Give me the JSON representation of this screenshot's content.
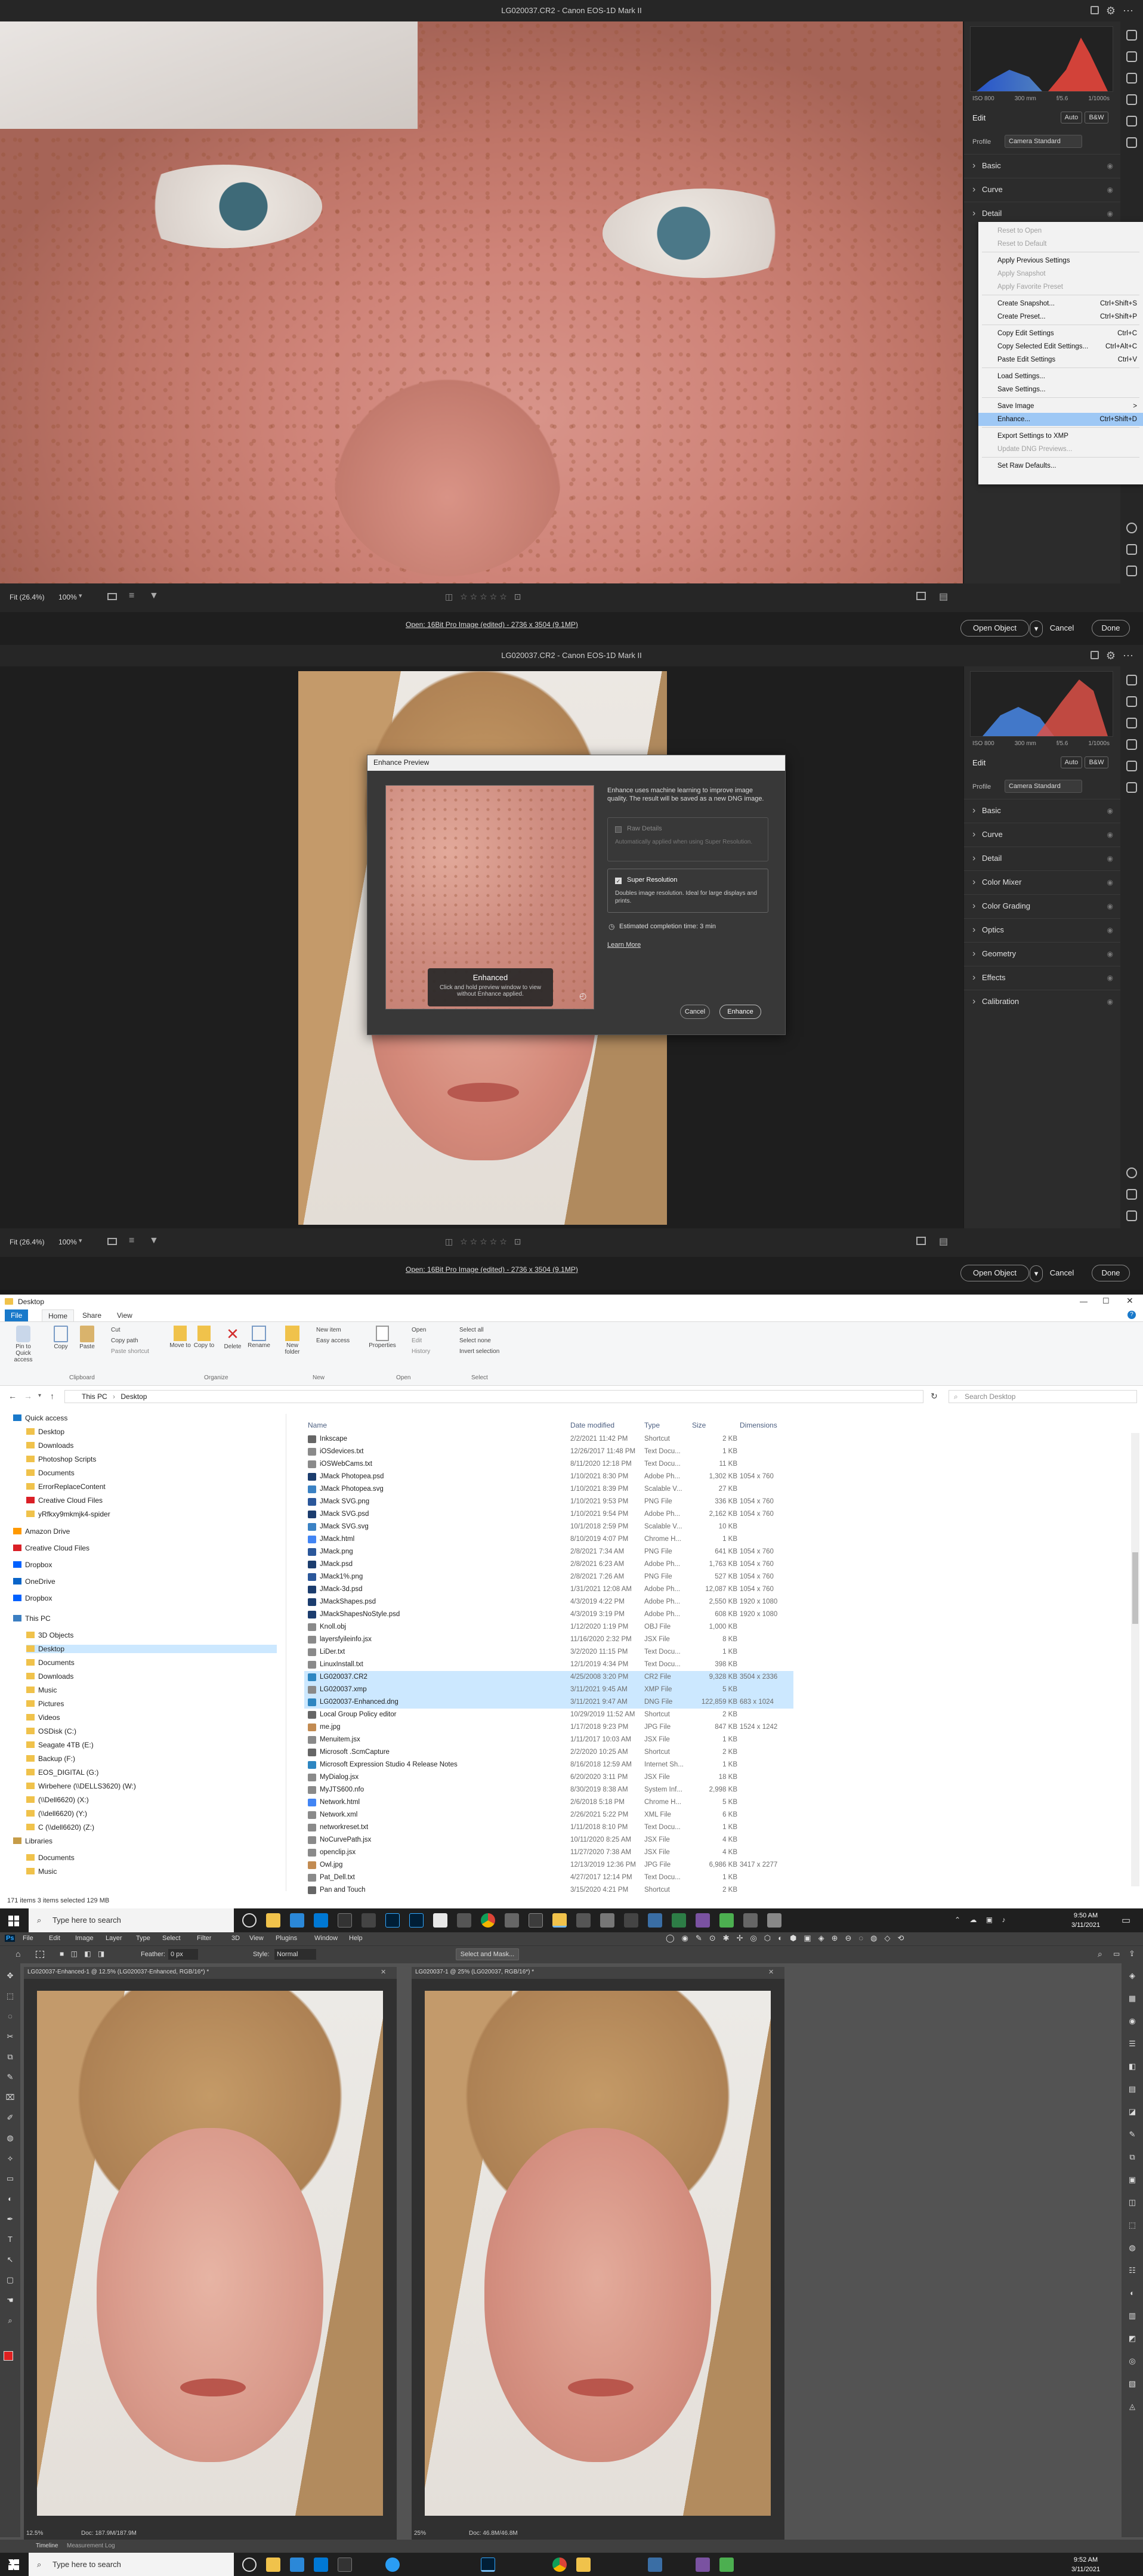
{
  "acr1": {
    "title": "LG020037.CR2  -  Canon EOS-1D Mark II",
    "histogram_info": [
      "ISO 800",
      "300 mm",
      "f/5.6",
      "1/1000s"
    ],
    "edit_label": "Edit",
    "auto_label": "Auto",
    "bw_label": "B&W",
    "profile_label": "Profile",
    "profile_value": "Camera Standard",
    "panels": [
      "Basic",
      "Curve",
      "Detail"
    ],
    "zoom_fit": "Fit (26.4%)",
    "zoom_100": "100%",
    "file_info": "Open: 16Bit Pro Image (edited) - 2736 x 3504 (9.1MP)",
    "open_button": "Open Object",
    "cancel_button": "Cancel",
    "done_button": "Done",
    "menu": [
      {
        "label": "Reset to Open",
        "disabled": true
      },
      {
        "label": "Reset to Default",
        "disabled": true
      },
      {
        "sep": true
      },
      {
        "label": "Apply Previous Settings"
      },
      {
        "label": "Apply Snapshot",
        "disabled": true
      },
      {
        "label": "Apply Favorite Preset",
        "disabled": true
      },
      {
        "sep": true
      },
      {
        "label": "Create Snapshot...",
        "shortcut": "Ctrl+Shift+S"
      },
      {
        "label": "Create Preset...",
        "shortcut": "Ctrl+Shift+P"
      },
      {
        "sep": true
      },
      {
        "label": "Copy Edit Settings",
        "shortcut": "Ctrl+C"
      },
      {
        "label": "Copy Selected Edit Settings...",
        "shortcut": "Ctrl+Alt+C"
      },
      {
        "label": "Paste Edit Settings",
        "shortcut": "Ctrl+V"
      },
      {
        "sep": true
      },
      {
        "label": "Load Settings..."
      },
      {
        "label": "Save Settings..."
      },
      {
        "sep": true
      },
      {
        "label": "Save Image",
        "shortcut": ">"
      },
      {
        "label": "Enhance...",
        "shortcut": "Ctrl+Shift+D",
        "highlight": true
      },
      {
        "sep": true
      },
      {
        "label": "Export Settings to XMP"
      },
      {
        "label": "Update DNG Previews...",
        "disabled": true
      },
      {
        "sep": true
      },
      {
        "label": "Set Raw Defaults..."
      }
    ]
  },
  "acr2": {
    "title": "LG020037.CR2  -  Canon EOS-1D Mark II",
    "histogram_info": [
      "ISO 800",
      "300 mm",
      "f/5.6",
      "1/1000s"
    ],
    "edit_label": "Edit",
    "auto_label": "Auto",
    "bw_label": "B&W",
    "profile_label": "Profile",
    "profile_value": "Camera Standard",
    "panels": [
      "Basic",
      "Curve",
      "Detail",
      "Color Mixer",
      "Color Grading",
      "Optics",
      "Geometry",
      "Effects",
      "Calibration"
    ],
    "zoom_fit": "Fit (26.4%)",
    "zoom_100": "100%",
    "file_info": "Open: 16Bit Pro Image (edited) - 2736 x 3504 (9.1MP)",
    "open_button": "Open Object",
    "cancel_button": "Cancel",
    "done_button": "Done",
    "dialog": {
      "title": "Enhance Preview",
      "description": "Enhance uses machine learning to improve image quality. The result will be saved as a new DNG image.",
      "raw_details_label": "Raw Details",
      "raw_details_desc": "Automatically applied when using Super Resolution.",
      "super_res_label": "Super Resolution",
      "super_res_desc": "Doubles image resolution. Ideal for large displays and prints.",
      "estimate": "Estimated completion time: 3 min",
      "learn_more": "Learn More",
      "tooltip_title": "Enhanced",
      "tooltip_desc": "Click and hold preview window to view without Enhance applied.",
      "cancel": "Cancel",
      "enhance": "Enhance"
    }
  },
  "explorer": {
    "window_title": "Desktop",
    "tabs": [
      "File",
      "Home",
      "Share",
      "View"
    ],
    "ribbon": {
      "pin": "Pin to Quick access",
      "copy": "Copy",
      "paste": "Paste",
      "cut": "Cut",
      "copy_path": "Copy path",
      "paste_shortcut": "Paste shortcut",
      "move_to": "Move to",
      "copy_to": "Copy to",
      "delete": "Delete",
      "rename": "Rename",
      "new_folder": "New folder",
      "new_item": "New item",
      "easy_access": "Easy access",
      "properties": "Properties",
      "open": "Open",
      "edit": "Edit",
      "history": "History",
      "select_all": "Select all",
      "select_none": "Select none",
      "invert": "Invert selection",
      "groups": [
        "Clipboard",
        "Organize",
        "New",
        "Open",
        "Select"
      ]
    },
    "path": [
      "This PC",
      "Desktop"
    ],
    "search_placeholder": "Search Desktop",
    "nav": [
      "Quick access",
      "Desktop",
      "Downloads",
      "Photoshop Scripts",
      "Documents",
      "ErrorReplaceContent",
      "Creative Cloud Files",
      "yRfkxy9mkmjk4-spider",
      "Amazon Drive",
      "Creative Cloud Files",
      "Dropbox",
      "OneDrive",
      "Dropbox",
      "This PC",
      "3D Objects",
      "Desktop",
      "Documents",
      "Downloads",
      "Music",
      "Pictures",
      "Videos",
      "OSDisk (C:)",
      "Seagate 4TB (E:)",
      "Backup (F:)",
      "EOS_DIGITAL (G:)",
      "Wirbehere (\\\\DELLS3620) (W:)",
      "(\\\\Dell6620) (X:)",
      "(\\\\dell6620) (Y:)",
      "C (\\\\dell6620) (Z:)",
      "Libraries",
      "Documents",
      "Music"
    ],
    "columns": [
      "Name",
      "Date modified",
      "Type",
      "Size",
      "Dimensions"
    ],
    "files": [
      {
        "name": "Inkscape",
        "date": "2/2/2021 11:42 PM",
        "type": "Shortcut",
        "size": "2 KB",
        "dim": "",
        "color": "#666"
      },
      {
        "name": "iOSdevices.txt",
        "date": "12/26/2017 11:48 PM",
        "type": "Text Docu...",
        "size": "1 KB",
        "dim": "",
        "color": "#8a8a8a"
      },
      {
        "name": "iOSWebCams.txt",
        "date": "8/11/2020 12:18 PM",
        "type": "Text Docu...",
        "size": "11 KB",
        "dim": "",
        "color": "#8a8a8a"
      },
      {
        "name": "JMack Photopea.psd",
        "date": "1/10/2021 8:30 PM",
        "type": "Adobe Ph...",
        "size": "1,302 KB",
        "dim": "1054 x 760",
        "color": "#1c3d6e"
      },
      {
        "name": "JMack Photopea.svg",
        "date": "1/10/2021 8:39 PM",
        "type": "Scalable V...",
        "size": "27 KB",
        "dim": "",
        "color": "#3b82c4"
      },
      {
        "name": "JMack SVG.png",
        "date": "1/10/2021 9:53 PM",
        "type": "PNG File",
        "size": "336 KB",
        "dim": "1054 x 760",
        "color": "#2b579a"
      },
      {
        "name": "JMack SVG.psd",
        "date": "1/10/2021 9:54 PM",
        "type": "Adobe Ph...",
        "size": "2,162 KB",
        "dim": "1054 x 760",
        "color": "#1c3d6e"
      },
      {
        "name": "JMack SVG.svg",
        "date": "10/1/2018 2:59 PM",
        "type": "Scalable V...",
        "size": "10 KB",
        "dim": "",
        "color": "#3b82c4"
      },
      {
        "name": "JMack.html",
        "date": "8/10/2019 4:07 PM",
        "type": "Chrome H...",
        "size": "1 KB",
        "dim": "",
        "color": "#4285f4"
      },
      {
        "name": "JMack.png",
        "date": "2/8/2021 7:34 AM",
        "type": "PNG File",
        "size": "641 KB",
        "dim": "1054 x 760",
        "color": "#2b579a"
      },
      {
        "name": "JMack.psd",
        "date": "2/8/2021 6:23 AM",
        "type": "Adobe Ph...",
        "size": "1,763 KB",
        "dim": "1054 x 760",
        "color": "#1c3d6e"
      },
      {
        "name": "JMack1%.png",
        "date": "2/8/2021 7:26 AM",
        "type": "PNG File",
        "size": "527 KB",
        "dim": "1054 x 760",
        "color": "#2b579a"
      },
      {
        "name": "JMack-3d.psd",
        "date": "1/31/2021 12:08 AM",
        "type": "Adobe Ph...",
        "size": "12,087 KB",
        "dim": "1054 x 760",
        "color": "#1c3d6e"
      },
      {
        "name": "JMackShapes.psd",
        "date": "4/3/2019 4:22 PM",
        "type": "Adobe Ph...",
        "size": "2,550 KB",
        "dim": "1920 x 1080",
        "color": "#1c3d6e"
      },
      {
        "name": "JMackShapesNoStyle.psd",
        "date": "4/3/2019 3:19 PM",
        "type": "Adobe Ph...",
        "size": "608 KB",
        "dim": "1920 x 1080",
        "color": "#1c3d6e"
      },
      {
        "name": "Knoll.obj",
        "date": "1/12/2020 1:19 PM",
        "type": "OBJ File",
        "size": "1,000 KB",
        "dim": "",
        "color": "#8a8a8a"
      },
      {
        "name": "layersfyileinfo.jsx",
        "date": "11/16/2020 2:32 PM",
        "type": "JSX File",
        "size": "8 KB",
        "dim": "",
        "color": "#8a8a8a"
      },
      {
        "name": "LiDer.txt",
        "date": "3/2/2020 11:15 PM",
        "type": "Text Docu...",
        "size": "1 KB",
        "dim": "",
        "color": "#8a8a8a"
      },
      {
        "name": "LinuxInstall.txt",
        "date": "12/1/2019 4:34 PM",
        "type": "Text Docu...",
        "size": "398 KB",
        "dim": "",
        "color": "#8a8a8a"
      },
      {
        "name": "LG020037.CR2",
        "date": "4/25/2008 3:20 PM",
        "type": "CR2 File",
        "size": "9,328 KB",
        "dim": "3504 x 2336",
        "color": "#2e86c1",
        "selected": true
      },
      {
        "name": "LG020037.xmp",
        "date": "3/11/2021 9:45 AM",
        "type": "XMP File",
        "size": "5 KB",
        "dim": "",
        "color": "#8a8a8a",
        "selected": true
      },
      {
        "name": "LG020037-Enhanced.dng",
        "date": "3/11/2021 9:47 AM",
        "type": "DNG File",
        "size": "122,859 KB",
        "dim": "683 x 1024",
        "color": "#2e86c1",
        "selected": true
      },
      {
        "name": "Local Group Policy editor",
        "date": "10/29/2019 11:52 AM",
        "type": "Shortcut",
        "size": "2 KB",
        "dim": "",
        "color": "#666"
      },
      {
        "name": "me.jpg",
        "date": "1/17/2018 9:23 PM",
        "type": "JPG File",
        "size": "847 KB",
        "dim": "1524 x 1242",
        "color": "#c28b52"
      },
      {
        "name": "Menuitem.jsx",
        "date": "1/11/2017 10:03 AM",
        "type": "JSX File",
        "size": "1 KB",
        "dim": "",
        "color": "#8a8a8a"
      },
      {
        "name": "Microsoft .ScmCapture",
        "date": "2/2/2020 10:25 AM",
        "type": "Shortcut",
        "size": "2 KB",
        "dim": "",
        "color": "#666"
      },
      {
        "name": "Microsoft Expression Studio 4 Release Notes",
        "date": "8/16/2018 12:59 AM",
        "type": "Internet Sh...",
        "size": "1 KB",
        "dim": "",
        "color": "#2e86c1"
      },
      {
        "name": "MyDialog.jsx",
        "date": "6/20/2020 3:11 PM",
        "type": "JSX File",
        "size": "18 KB",
        "dim": "",
        "color": "#8a8a8a"
      },
      {
        "name": "MyJTS600.nfo",
        "date": "8/30/2019 8:38 AM",
        "type": "System Inf...",
        "size": "2,998 KB",
        "dim": "",
        "color": "#8a8a8a"
      },
      {
        "name": "Network.html",
        "date": "2/6/2018 5:18 PM",
        "type": "Chrome H...",
        "size": "5 KB",
        "dim": "",
        "color": "#4285f4"
      },
      {
        "name": "Network.xml",
        "date": "2/26/2021 5:22 PM",
        "type": "XML File",
        "size": "6 KB",
        "dim": "",
        "color": "#8a8a8a"
      },
      {
        "name": "networkreset.txt",
        "date": "1/11/2018 8:10 PM",
        "type": "Text Docu...",
        "size": "1 KB",
        "dim": "",
        "color": "#8a8a8a"
      },
      {
        "name": "NoCurvePath.jsx",
        "date": "10/11/2020 8:25 AM",
        "type": "JSX File",
        "size": "4 KB",
        "dim": "",
        "color": "#8a8a8a"
      },
      {
        "name": "openclip.jsx",
        "date": "11/27/2020 7:38 AM",
        "type": "JSX File",
        "size": "4 KB",
        "dim": "",
        "color": "#8a8a8a"
      },
      {
        "name": "Owl.jpg",
        "date": "12/13/2019 12:36 PM",
        "type": "JPG File",
        "size": "6,986 KB",
        "dim": "3417 x 2277",
        "color": "#c28b52"
      },
      {
        "name": "Pat_Dell.txt",
        "date": "4/27/2017 12:14 PM",
        "type": "Text Docu...",
        "size": "1 KB",
        "dim": "",
        "color": "#8a8a8a"
      },
      {
        "name": "Pan and Touch",
        "date": "3/15/2020 4:21 PM",
        "type": "Shortcut",
        "size": "2 KB",
        "dim": "",
        "color": "#666"
      }
    ],
    "status": "171 items    3 items selected  129 MB"
  },
  "taskbar1": {
    "search": "Type here to search",
    "time": "9:50 AM",
    "date": "3/11/2021"
  },
  "taskbar2": {
    "search": "Type here to search",
    "time": "9:52 AM",
    "date": "3/11/2021"
  },
  "photoshop": {
    "menu": [
      "Ps",
      "File",
      "Edit",
      "Image",
      "Layer",
      "Type",
      "Select",
      "Filter",
      "3D",
      "View",
      "Plugins",
      "Window",
      "Help"
    ],
    "options": {
      "feather_label": "Feather:",
      "feather_value": "0 px",
      "style_label": "Style:",
      "style_value": "Normal",
      "select_mask": "Select and Mask..."
    },
    "doc1_tab": "LG020037-Enhanced-1 @ 12.5% (LG020037-Enhanced, RGB/16*) *",
    "doc2_tab": "LG020037-1 @ 25% (LG020037, RGB/16*) *",
    "doc1_zoom": "12.5%",
    "doc1_info": "Doc: 187.9M/187.9M",
    "doc2_zoom": "25%",
    "doc2_info": "Doc: 46.8M/46.8M",
    "bottom_tabs": [
      "Timeline",
      "Measurement Log"
    ]
  }
}
